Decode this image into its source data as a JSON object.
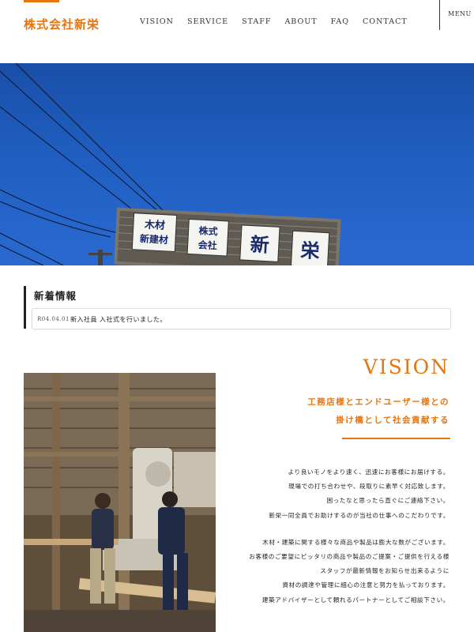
{
  "header": {
    "logo": "株式会社新栄",
    "nav": [
      "VISION",
      "SERVICE",
      "STAFF",
      "ABOUT",
      "FAQ",
      "CONTACT"
    ],
    "menu_label": "MENU"
  },
  "hero": {
    "sign_left": [
      "木材",
      "新建材"
    ],
    "sign_middle": [
      "株式",
      "会社"
    ],
    "sign_chars": [
      "新",
      "栄"
    ]
  },
  "news": {
    "title": "新着情報",
    "items": [
      {
        "date": "R04.04.01",
        "text": "新入社員 入社式を行いました。"
      }
    ]
  },
  "vision": {
    "heading": "VISION",
    "subtitle": [
      "工務店様とエンドユーザー様との",
      "掛け橋として社会貢献する"
    ],
    "paragraph1": [
      "より良いモノをより速く、迅速にお客様にお届けする。",
      "現場での打ち合わせや、段取りに素早く対応致します。",
      "困ったなと思ったら直ぐにご連絡下さい。",
      "新栄一同全員でお助けするのが当社の仕事へのこだわりです。"
    ],
    "paragraph2": [
      "木材・建築に関する様々な商品や製品は膨大な数がございます。",
      "お客様のご要望にピッタリの商品や製品のご提案・ご提供を行える様",
      "スタッフが最新情報をお知らせ出来るように",
      "資材の調達や管理に細心の注意と努力を払っております。",
      "建築アドバイザーとして頼れるパートナーとしてご相談下さい。"
    ]
  },
  "colors": {
    "accent": "#e8740c",
    "sky": "#1f5ec0"
  }
}
